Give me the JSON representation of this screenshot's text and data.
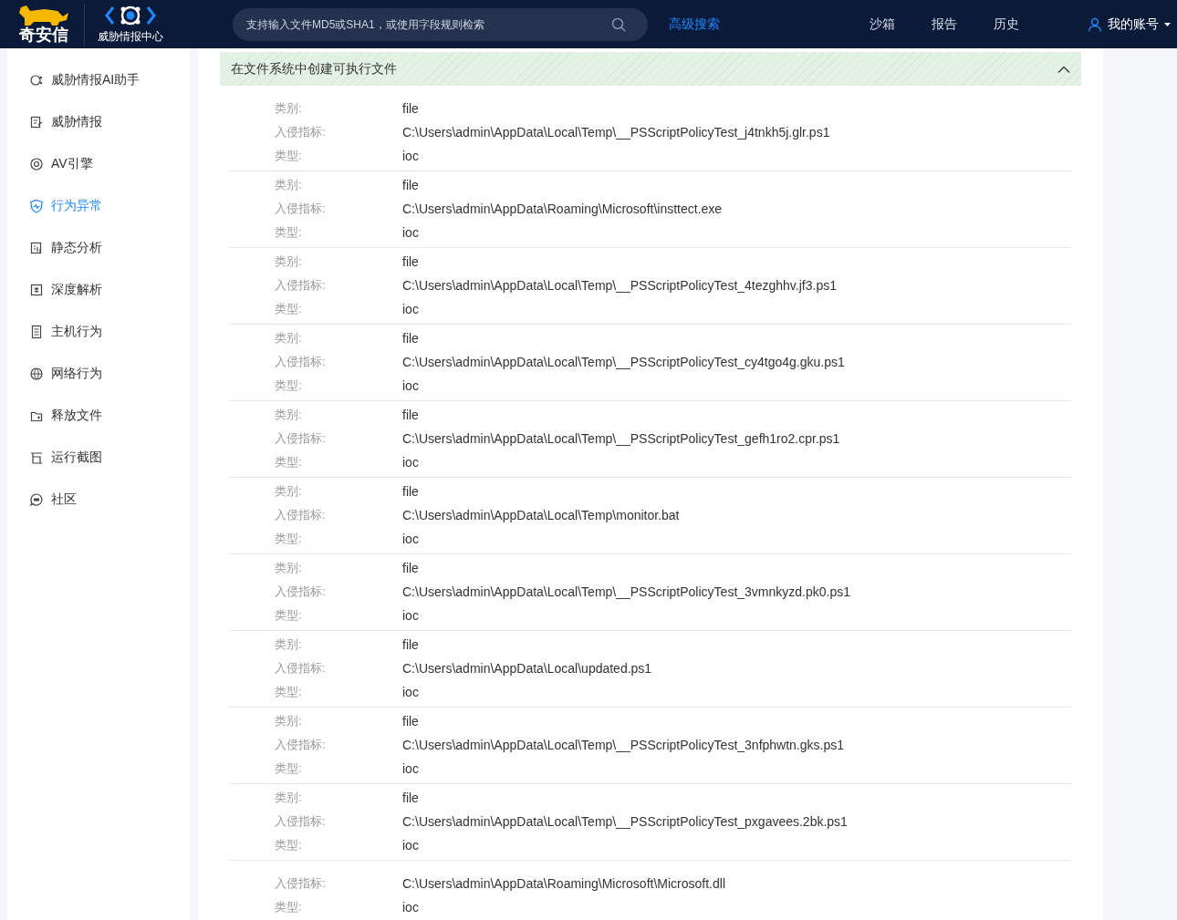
{
  "header": {
    "brand": "奇安信",
    "product": "威胁情报中心",
    "search": {
      "placeholder": "支持输入文件MD5或SHA1，或使用字段规则检索"
    },
    "advanced_search": "高级搜索",
    "nav": [
      {
        "label": "沙箱"
      },
      {
        "label": "报告"
      },
      {
        "label": "历史"
      }
    ],
    "account": "我的账号"
  },
  "sidebar": {
    "items": [
      {
        "label": "威胁情报AI助手",
        "selected": false
      },
      {
        "label": "威胁情报",
        "selected": false
      },
      {
        "label": "AV引擎",
        "selected": false
      },
      {
        "label": "行为异常",
        "selected": true
      },
      {
        "label": "静态分析",
        "selected": false
      },
      {
        "label": "深度解析",
        "selected": false
      },
      {
        "label": "主机行为",
        "selected": false
      },
      {
        "label": "网络行为",
        "selected": false
      },
      {
        "label": "释放文件",
        "selected": false
      },
      {
        "label": "运行截图",
        "selected": false
      },
      {
        "label": "社区",
        "selected": false
      }
    ]
  },
  "section": {
    "title": "在文件系统中创建可执行文件",
    "expanded": true,
    "entries": [
      {
        "fields": [
          {
            "label": "类别:",
            "value": "file"
          },
          {
            "label": "入侵指标:",
            "value": "C:\\Users\\admin\\AppData\\Local\\Temp\\__PSScriptPolicyTest_j4tnkh5j.glr.ps1"
          },
          {
            "label": "类型:",
            "value": "ioc"
          }
        ]
      },
      {
        "fields": [
          {
            "label": "类别:",
            "value": "file"
          },
          {
            "label": "入侵指标:",
            "value": "C:\\Users\\admin\\AppData\\Roaming\\Microsoft\\insttect.exe"
          },
          {
            "label": "类型:",
            "value": "ioc"
          }
        ]
      },
      {
        "fields": [
          {
            "label": "类别:",
            "value": "file"
          },
          {
            "label": "入侵指标:",
            "value": "C:\\Users\\admin\\AppData\\Local\\Temp\\__PSScriptPolicyTest_4tezghhv.jf3.ps1"
          },
          {
            "label": "类型:",
            "value": "ioc"
          }
        ]
      },
      {
        "fields": [
          {
            "label": "类别:",
            "value": "file"
          },
          {
            "label": "入侵指标:",
            "value": "C:\\Users\\admin\\AppData\\Local\\Temp\\__PSScriptPolicyTest_cy4tgo4g.gku.ps1"
          },
          {
            "label": "类型:",
            "value": "ioc"
          }
        ]
      },
      {
        "fields": [
          {
            "label": "类别:",
            "value": "file"
          },
          {
            "label": "入侵指标:",
            "value": "C:\\Users\\admin\\AppData\\Local\\Temp\\__PSScriptPolicyTest_gefh1ro2.cpr.ps1"
          },
          {
            "label": "类型:",
            "value": "ioc"
          }
        ]
      },
      {
        "fields": [
          {
            "label": "类别:",
            "value": "file"
          },
          {
            "label": "入侵指标:",
            "value": "C:\\Users\\admin\\AppData\\Local\\Temp\\monitor.bat"
          },
          {
            "label": "类型:",
            "value": "ioc"
          }
        ]
      },
      {
        "fields": [
          {
            "label": "类别:",
            "value": "file"
          },
          {
            "label": "入侵指标:",
            "value": "C:\\Users\\admin\\AppData\\Local\\Temp\\__PSScriptPolicyTest_3vmnkyzd.pk0.ps1"
          },
          {
            "label": "类型:",
            "value": "ioc"
          }
        ]
      },
      {
        "fields": [
          {
            "label": "类别:",
            "value": "file"
          },
          {
            "label": "入侵指标:",
            "value": "C:\\Users\\admin\\AppData\\Local\\updated.ps1"
          },
          {
            "label": "类型:",
            "value": "ioc"
          }
        ]
      },
      {
        "fields": [
          {
            "label": "类别:",
            "value": "file"
          },
          {
            "label": "入侵指标:",
            "value": "C:\\Users\\admin\\AppData\\Local\\Temp\\__PSScriptPolicyTest_3nfphwtn.gks.ps1"
          },
          {
            "label": "类型:",
            "value": "ioc"
          }
        ]
      },
      {
        "fields": [
          {
            "label": "类别:",
            "value": "file"
          },
          {
            "label": "入侵指标:",
            "value": "C:\\Users\\admin\\AppData\\Local\\Temp\\__PSScriptPolicyTest_pxgavees.2bk.ps1"
          },
          {
            "label": "类型:",
            "value": "ioc"
          }
        ]
      },
      {
        "fields": [
          {
            "label": "入侵指标:",
            "value": "C:\\Users\\admin\\AppData\\Roaming\\Microsoft\\Microsoft.dll"
          },
          {
            "label": "类型:",
            "value": "ioc"
          }
        ]
      }
    ]
  }
}
